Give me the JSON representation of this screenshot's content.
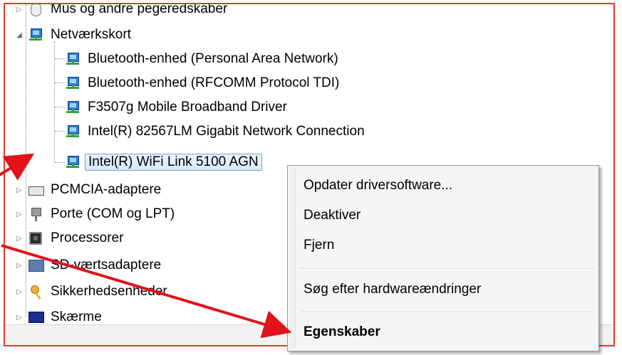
{
  "tree": {
    "partial_top": "Mus og andre pegeredskaber",
    "category": "Netværkskort",
    "network_adapters": [
      "Bluetooth-enhed (Personal Area Network)",
      "Bluetooth-enhed (RFCOMM Protocol TDI)",
      "F3507g Mobile Broadband Driver",
      "Intel(R) 82567LM Gigabit Network Connection",
      "Intel(R) WiFi Link 5100 AGN"
    ],
    "other_categories": [
      "PCMCIA-adaptere",
      "Porte (COM og LPT)",
      "Processorer",
      "SD-værtsadaptere",
      "Sikkerhedsenheder",
      "Skærme"
    ]
  },
  "context_menu": {
    "items": [
      "Opdater driversoftware...",
      "Deaktiver",
      "Fjern",
      "Søg efter hardwareændringer",
      "Egenskaber"
    ]
  },
  "colors": {
    "frame_border": "#e23b2c",
    "arrow": "#e2121b",
    "selection": "#d9e9fc"
  }
}
